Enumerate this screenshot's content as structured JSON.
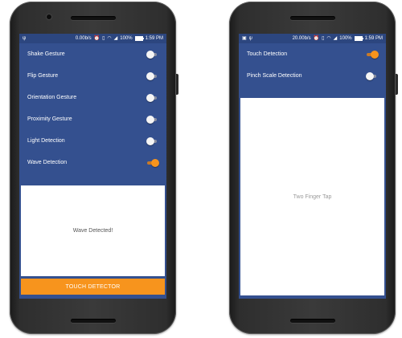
{
  "left_phone": {
    "status": {
      "speed": "0.00b/s",
      "battery": "100%",
      "time": "1:59 PM",
      "battery_level": 1.0
    },
    "rows": [
      {
        "label": "Shake Gesture",
        "on": false
      },
      {
        "label": "Flip Gesture",
        "on": false
      },
      {
        "label": "Orientation Gesture",
        "on": false
      },
      {
        "label": "Proximity Gesture",
        "on": false
      },
      {
        "label": "Light Detection",
        "on": false
      },
      {
        "label": "Wave Detection",
        "on": true
      }
    ],
    "panel_text": "Wave Detected!",
    "button_label": "TOUCH DETECTOR"
  },
  "right_phone": {
    "status": {
      "speed": "20.00b/s",
      "battery": "100%",
      "time": "1:59 PM",
      "battery_level": 1.0
    },
    "rows": [
      {
        "label": "Touch Detection",
        "on": true
      },
      {
        "label": "Pinch Scale Detection",
        "on": false
      }
    ],
    "panel_text": "Two Finger Tap"
  },
  "colors": {
    "screen_bg": "#34508f",
    "accent": "#f7941d",
    "panel_bg": "#ffffff"
  },
  "icons": [
    "usb-icon",
    "image-icon",
    "alarm-icon",
    "vibrate-icon",
    "wifi-icon",
    "signal-icon",
    "battery-icon"
  ]
}
